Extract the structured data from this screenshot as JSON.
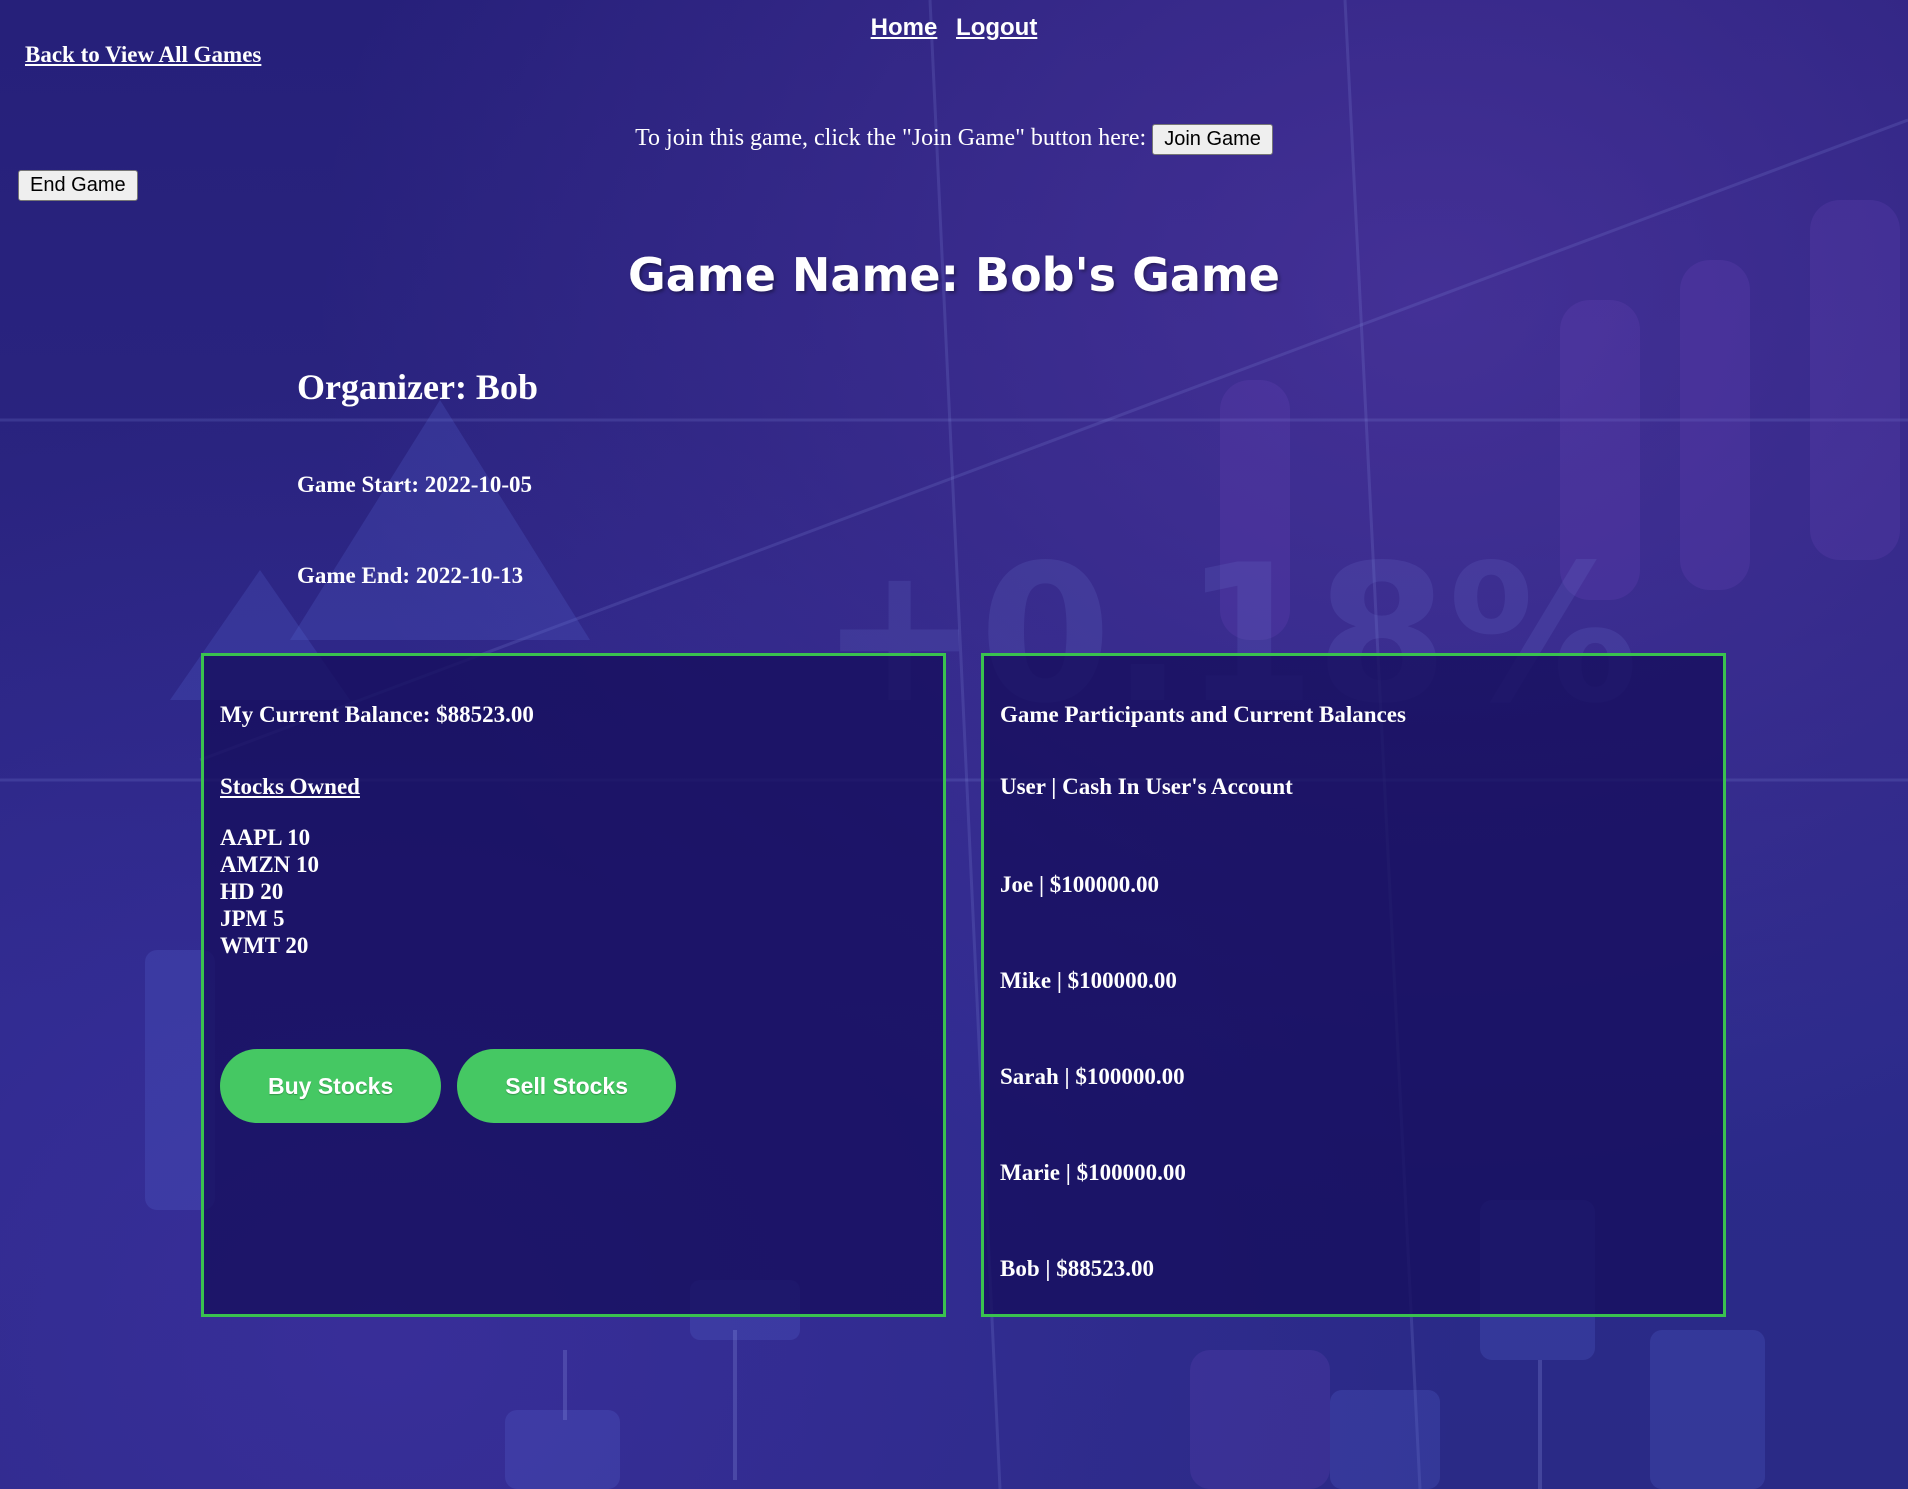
{
  "nav": {
    "home_label": "Home",
    "logout_label": "Logout",
    "back_label": "Back to View All Games"
  },
  "join": {
    "prompt": "To join this game, click the \"Join Game\" button here:",
    "button_label": "Join Game"
  },
  "end_game_label": "End Game",
  "game": {
    "title": "Game Name: Bob's Game",
    "organizer": "Organizer: Bob",
    "start": "Game Start: 2022-10-05",
    "end": "Game End: 2022-10-13"
  },
  "my_panel": {
    "balance": "My Current Balance: $88523.00",
    "stocks_heading": "Stocks Owned",
    "stocks": [
      "AAPL 10",
      "AMZN 10",
      "HD 20",
      "JPM 5",
      "WMT 20"
    ],
    "buy_label": "Buy Stocks",
    "sell_label": "Sell Stocks"
  },
  "participants_panel": {
    "title": "Game Participants and Current Balances",
    "columns": "User | Cash In User's Account",
    "rows": [
      "Joe | $100000.00",
      "Mike | $100000.00",
      "Sarah | $100000.00",
      "Marie | $100000.00",
      "Bob | $88523.00"
    ]
  },
  "colors": {
    "background": "#2a2480",
    "panel_border": "#3ac24f",
    "panel_fill": "#160e5c",
    "action_button": "#45c863",
    "text": "#ffffff"
  }
}
